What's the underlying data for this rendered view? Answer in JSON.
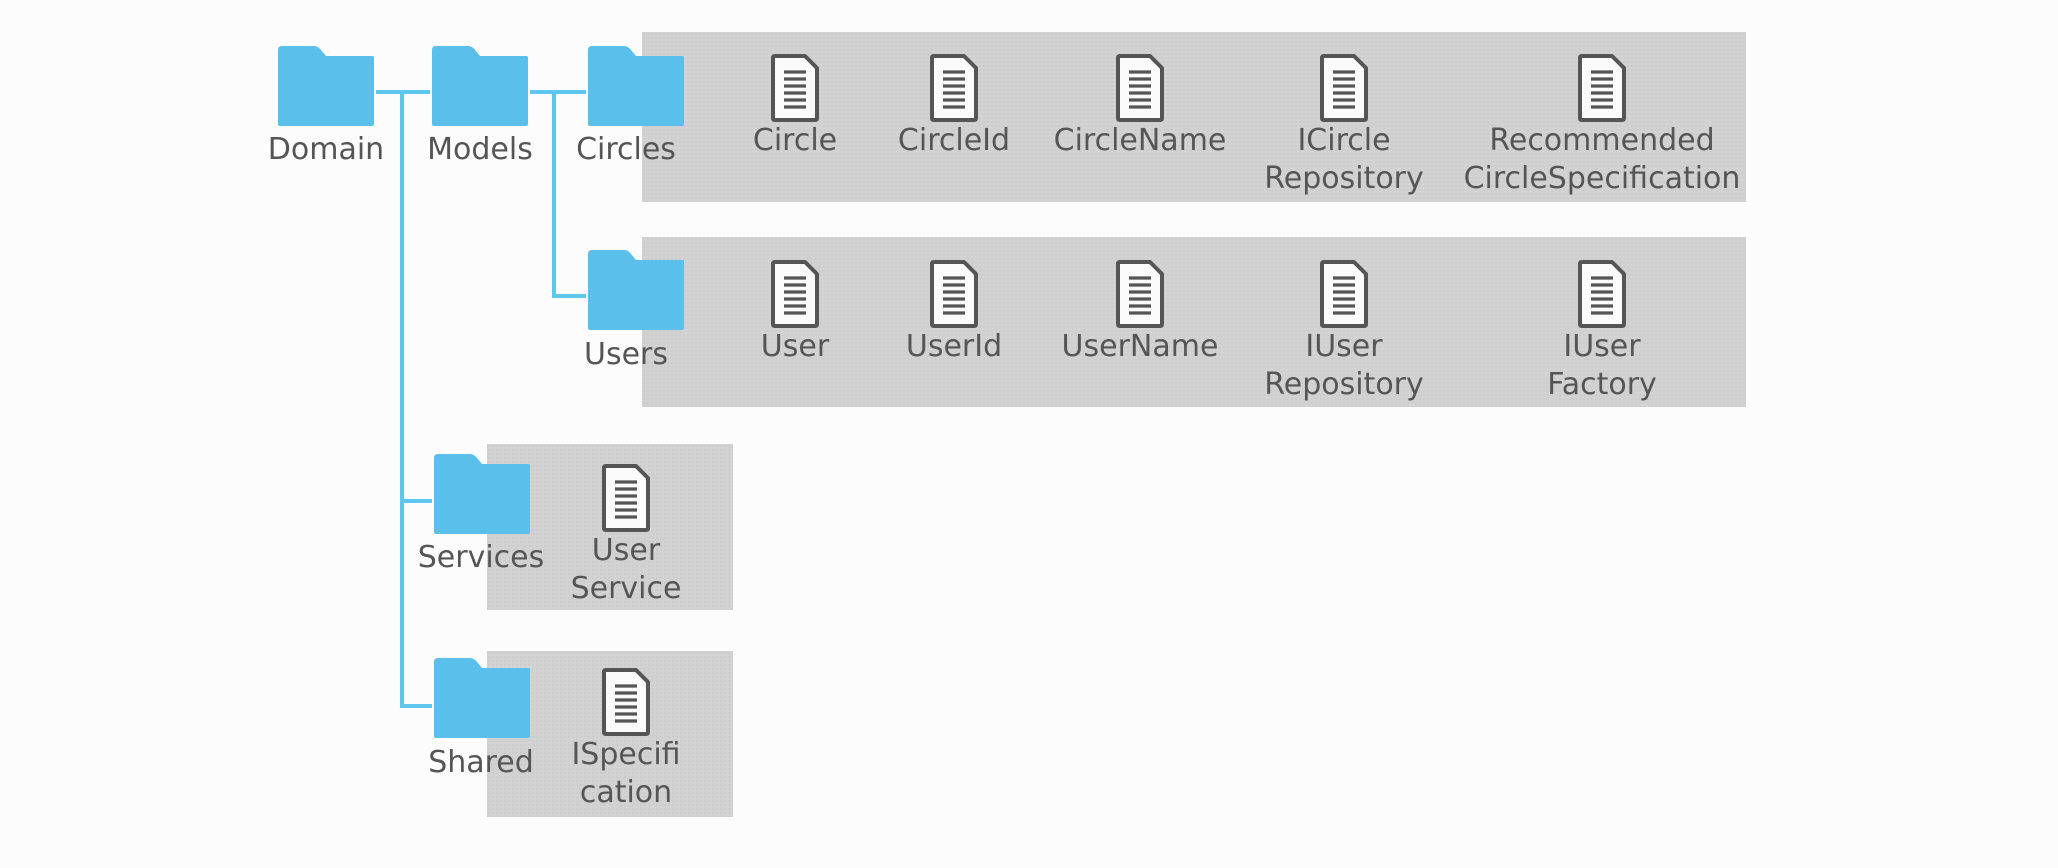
{
  "root": {
    "label": "Domain"
  },
  "models": {
    "label": "Models"
  },
  "circles": {
    "label": "Circles",
    "files": [
      {
        "lines": [
          "Circle"
        ]
      },
      {
        "lines": [
          "CircleId"
        ]
      },
      {
        "lines": [
          "CircleName"
        ]
      },
      {
        "lines": [
          "ICircle",
          "Repository"
        ]
      },
      {
        "lines": [
          "Recommended",
          "CircleSpecification"
        ]
      }
    ]
  },
  "users": {
    "label": "Users",
    "files": [
      {
        "lines": [
          "User"
        ]
      },
      {
        "lines": [
          "UserId"
        ]
      },
      {
        "lines": [
          "UserName"
        ]
      },
      {
        "lines": [
          "IUser",
          "Repository"
        ]
      },
      {
        "lines": [
          "IUser",
          "Factory"
        ]
      }
    ]
  },
  "services": {
    "label": "Services",
    "files": [
      {
        "lines": [
          "User",
          "Service"
        ]
      }
    ]
  },
  "shared": {
    "label": "Shared",
    "files": [
      {
        "lines": [
          "ISpecifi",
          "cation"
        ]
      }
    ]
  },
  "colors": {
    "folder": "#5bbfeb",
    "connector": "#5ec7ee",
    "panel": "#d2d2d2",
    "text": "#555555",
    "file_icon": "#555555"
  }
}
